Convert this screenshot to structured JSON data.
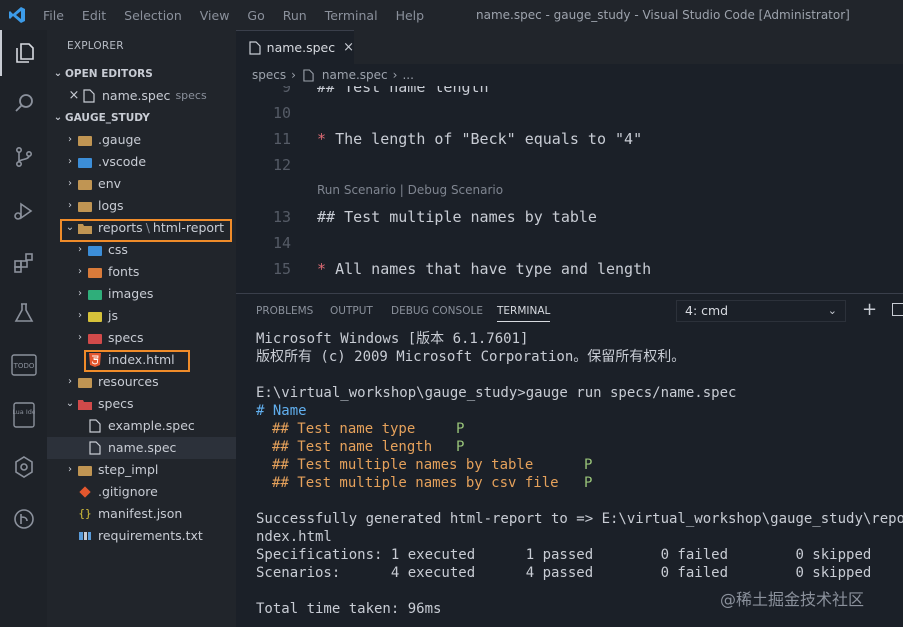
{
  "window": {
    "title": "name.spec - gauge_study - Visual Studio Code [Administrator]",
    "menu": [
      "File",
      "Edit",
      "Selection",
      "View",
      "Go",
      "Run",
      "Terminal",
      "Help"
    ]
  },
  "activity_bar": {
    "items": [
      {
        "icon": "files-icon"
      },
      {
        "icon": "search-icon"
      },
      {
        "icon": "source-control-icon"
      },
      {
        "icon": "run-debug-icon"
      },
      {
        "icon": "extensions-icon"
      },
      {
        "icon": "testing-flask-icon"
      },
      {
        "icon": "todo-icon",
        "label": "TODO"
      },
      {
        "icon": "lua-ide-icon",
        "label": "Lua Ide"
      },
      {
        "icon": "gitlens-icon"
      },
      {
        "icon": "git-graph-icon"
      }
    ]
  },
  "sidebar": {
    "header": "EXPLORER",
    "open_editors": {
      "label": "OPEN EDITORS",
      "items": [
        {
          "name": "name.spec",
          "folder": "specs"
        }
      ]
    },
    "workspace": {
      "label": "GAUGE_STUDY",
      "items": [
        {
          "name": ".gauge"
        },
        {
          "name": ".vscode"
        },
        {
          "name": "env"
        },
        {
          "name": "logs"
        },
        {
          "name": "reports",
          "sep": "\\",
          "sub": "html-report"
        },
        {
          "name": "css"
        },
        {
          "name": "fonts"
        },
        {
          "name": "images"
        },
        {
          "name": "js"
        },
        {
          "name": "specs"
        },
        {
          "name": "index.html"
        },
        {
          "name": "resources"
        },
        {
          "name": "specs"
        },
        {
          "name": "example.spec"
        },
        {
          "name": "name.spec"
        },
        {
          "name": "step_impl"
        },
        {
          "name": ".gitignore"
        },
        {
          "name": "manifest.json"
        },
        {
          "name": "requirements.txt"
        }
      ]
    }
  },
  "editor": {
    "tab": {
      "label": "name.spec"
    },
    "breadcrumbs": [
      "specs",
      "name.spec",
      "..."
    ],
    "lines": [
      {
        "num": "9",
        "text": "## Test name length"
      },
      {
        "num": "10",
        "text": ""
      },
      {
        "num": "11",
        "bullet": "*",
        "text": "The length of \"Beck\" equals to \"4\""
      },
      {
        "num": "12",
        "text": ""
      },
      {
        "num": "13",
        "text": "## Test multiple names by table"
      },
      {
        "num": "14",
        "text": ""
      },
      {
        "num": "15",
        "bullet": "*",
        "text": "All names that have type and length"
      }
    ],
    "codelens": "Run Scenario | Debug Scenario"
  },
  "panel": {
    "tabs": [
      "PROBLEMS",
      "OUTPUT",
      "DEBUG CONSOLE",
      "TERMINAL"
    ],
    "terminal_select": "4: cmd",
    "terminal": {
      "l1": "Microsoft Windows [版本 6.1.7601]",
      "l2": "版权所有 (c) 2009 Microsoft Corporation。保留所有权利。",
      "l4": "E:\\virtual_workshop\\gauge_study>gauge run specs/name.spec",
      "l5": "# Name",
      "s1": "## Test name type",
      "s2": "## Test name length",
      "s3": "## Test multiple names by table",
      "s4": "## Test multiple names by csv file",
      "pass": "P",
      "l10": "Successfully generated html-report to => E:\\virtual_workshop\\gauge_study\\reports\\",
      "l11": "ndex.html",
      "l12": "Specifications: 1 executed      1 passed        0 failed        0 skipped",
      "l13": "Scenarios:      4 executed      4 passed        0 failed        0 skipped",
      "l15": "Total time taken: 96ms"
    }
  },
  "watermark": "@稀土掘金技术社区",
  "colors": {
    "accent": "#f08c2a",
    "heading": "#e06c75",
    "pass": "#98c379",
    "terminal_blue": "#61afef"
  }
}
